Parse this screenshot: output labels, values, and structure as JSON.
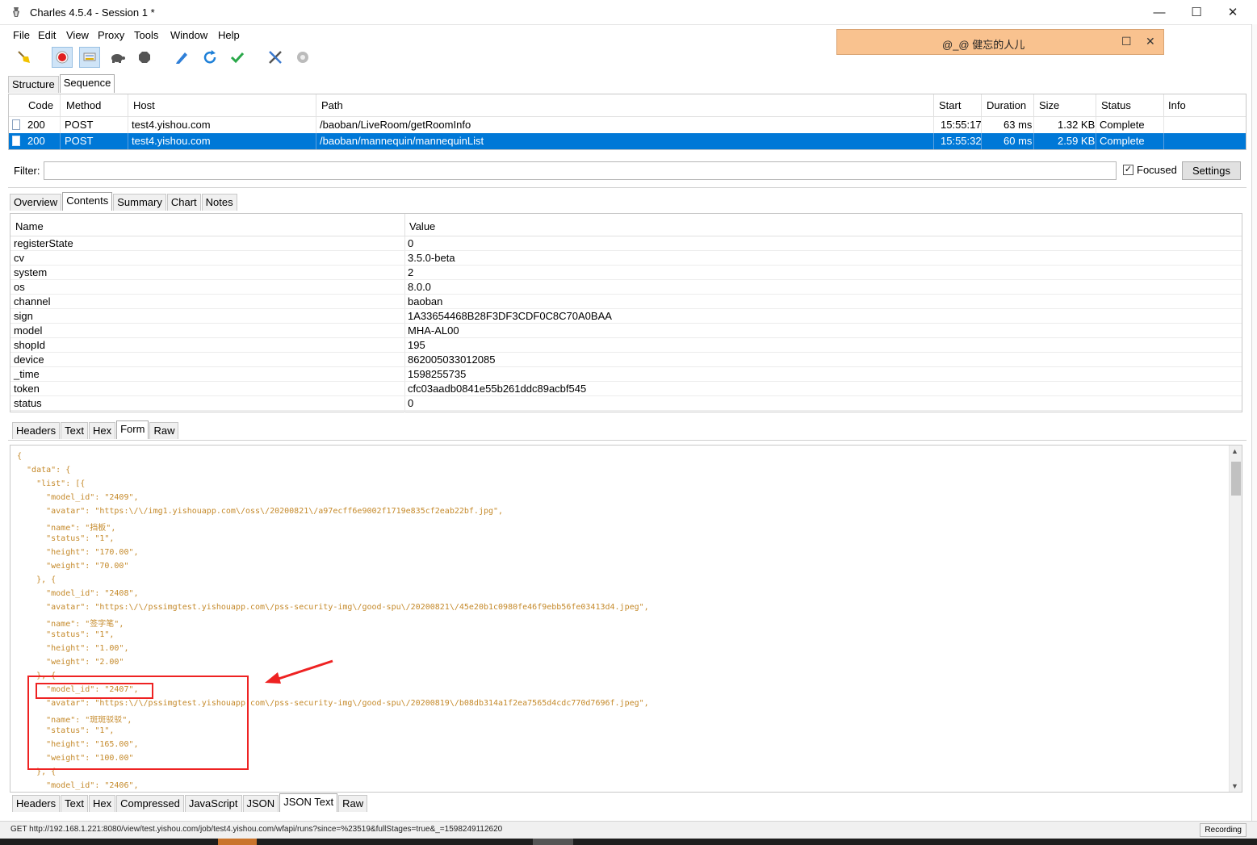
{
  "window": {
    "title": "Charles 4.5.4 - Session 1 *",
    "minimize": "—",
    "maximize": "☐",
    "close": "✕"
  },
  "menu": [
    "File",
    "Edit",
    "View",
    "Proxy",
    "Tools",
    "Window",
    "Help"
  ],
  "toolbar": {
    "icons": [
      "broom-icon",
      "record-icon",
      "throttle-icon",
      "turtle-icon",
      "stop-icon",
      "pen-icon",
      "refresh-icon",
      "check-icon",
      "tools-icon",
      "settings-icon"
    ]
  },
  "popup": {
    "text": "@_@   健忘的人儿",
    "restore": "☐",
    "close": "✕"
  },
  "top_tabs": [
    "Structure",
    "Sequence"
  ],
  "sequence": {
    "columns": [
      "Code",
      "Method",
      "Host",
      "Path",
      "Start",
      "Duration",
      "Size",
      "Status",
      "Info"
    ],
    "rows": [
      {
        "code": "200",
        "method": "POST",
        "host": "test4.yishou.com",
        "path": "/baoban/LiveRoom/getRoomInfo",
        "start": "15:55:17",
        "duration": "63 ms",
        "size": "1.32 KB",
        "status": "Complete",
        "info": ""
      },
      {
        "code": "200",
        "method": "POST",
        "host": "test4.yishou.com",
        "path": "/baoban/mannequin/mannequinList",
        "start": "15:55:32",
        "duration": "60 ms",
        "size": "2.59 KB",
        "status": "Complete",
        "info": ""
      }
    ]
  },
  "filter": {
    "label": "Filter:",
    "value": "",
    "focused_label": "Focused",
    "focused_checked": "✓",
    "settings_label": "Settings"
  },
  "detail_tabs": [
    "Overview",
    "Contents",
    "Summary",
    "Chart",
    "Notes"
  ],
  "form": {
    "col_name": "Name",
    "col_value": "Value",
    "rows": [
      {
        "name": "registerState",
        "value": "0"
      },
      {
        "name": "cv",
        "value": "3.5.0-beta"
      },
      {
        "name": "system",
        "value": "2"
      },
      {
        "name": "os",
        "value": "8.0.0"
      },
      {
        "name": "channel",
        "value": "baoban"
      },
      {
        "name": "sign",
        "value": "1A33654468B28F3DF3CDF0C8C70A0BAA"
      },
      {
        "name": "model",
        "value": "MHA-AL00"
      },
      {
        "name": "shopId",
        "value": "195"
      },
      {
        "name": "device",
        "value": "862005033012085"
      },
      {
        "name": "_time",
        "value": "1598255735"
      },
      {
        "name": "token",
        "value": "cfc03aadb0841e55b261ddc89acbf545"
      },
      {
        "name": "status",
        "value": "0"
      }
    ]
  },
  "request_tabs": [
    "Headers",
    "Text",
    "Hex",
    "Form",
    "Raw"
  ],
  "json_lines": [
    "{",
    "  \"data\": {",
    "    \"list\": [{",
    "      \"model_id\": \"2409\",",
    "      \"avatar\": \"https:\\/\\/img1.yishouapp.com\\/oss\\/20200821\\/a97ecff6e9002f1719e835cf2eab22bf.jpg\",",
    "      \"name\": \"挡板\",",
    "      \"status\": \"1\",",
    "      \"height\": \"170.00\",",
    "      \"weight\": \"70.00\"",
    "    }, {",
    "      \"model_id\": \"2408\",",
    "      \"avatar\": \"https:\\/\\/pssimgtest.yishouapp.com\\/pss-security-img\\/good-spu\\/20200821\\/45e20b1c0980fe46f9ebb56fe03413d4.jpeg\",",
    "      \"name\": \"签字笔\",",
    "      \"status\": \"1\",",
    "      \"height\": \"1.00\",",
    "      \"weight\": \"2.00\"",
    "    }, {",
    "      \"model_id\": \"2407\",",
    "      \"avatar\": \"https:\\/\\/pssimgtest.yishouapp.com\\/pss-security-img\\/good-spu\\/20200819\\/b08db314a1f2ea7565d4cdc770d7696f.jpeg\",",
    "      \"name\": \"斑斑驳驳\",",
    "      \"status\": \"1\",",
    "      \"height\": \"165.00\",",
    "      \"weight\": \"100.00\"",
    "    }, {",
    "      \"model_id\": \"2406\","
  ],
  "response_tabs": [
    "Headers",
    "Text",
    "Hex",
    "Compressed",
    "JavaScript",
    "JSON",
    "JSON Text",
    "Raw"
  ],
  "statusbar": {
    "text": "GET http://192.168.1.221:8080/view/test.yishou.com/job/test4.yishou.com/wfapi/runs?since=%23519&fullStages=true&_=1598249112620",
    "recording": "Recording"
  },
  "colors": {
    "selection": "#0078d7",
    "json_text": "#c58a2b",
    "annotation": "#ee2222",
    "popup_bg": "#f9c28f"
  }
}
